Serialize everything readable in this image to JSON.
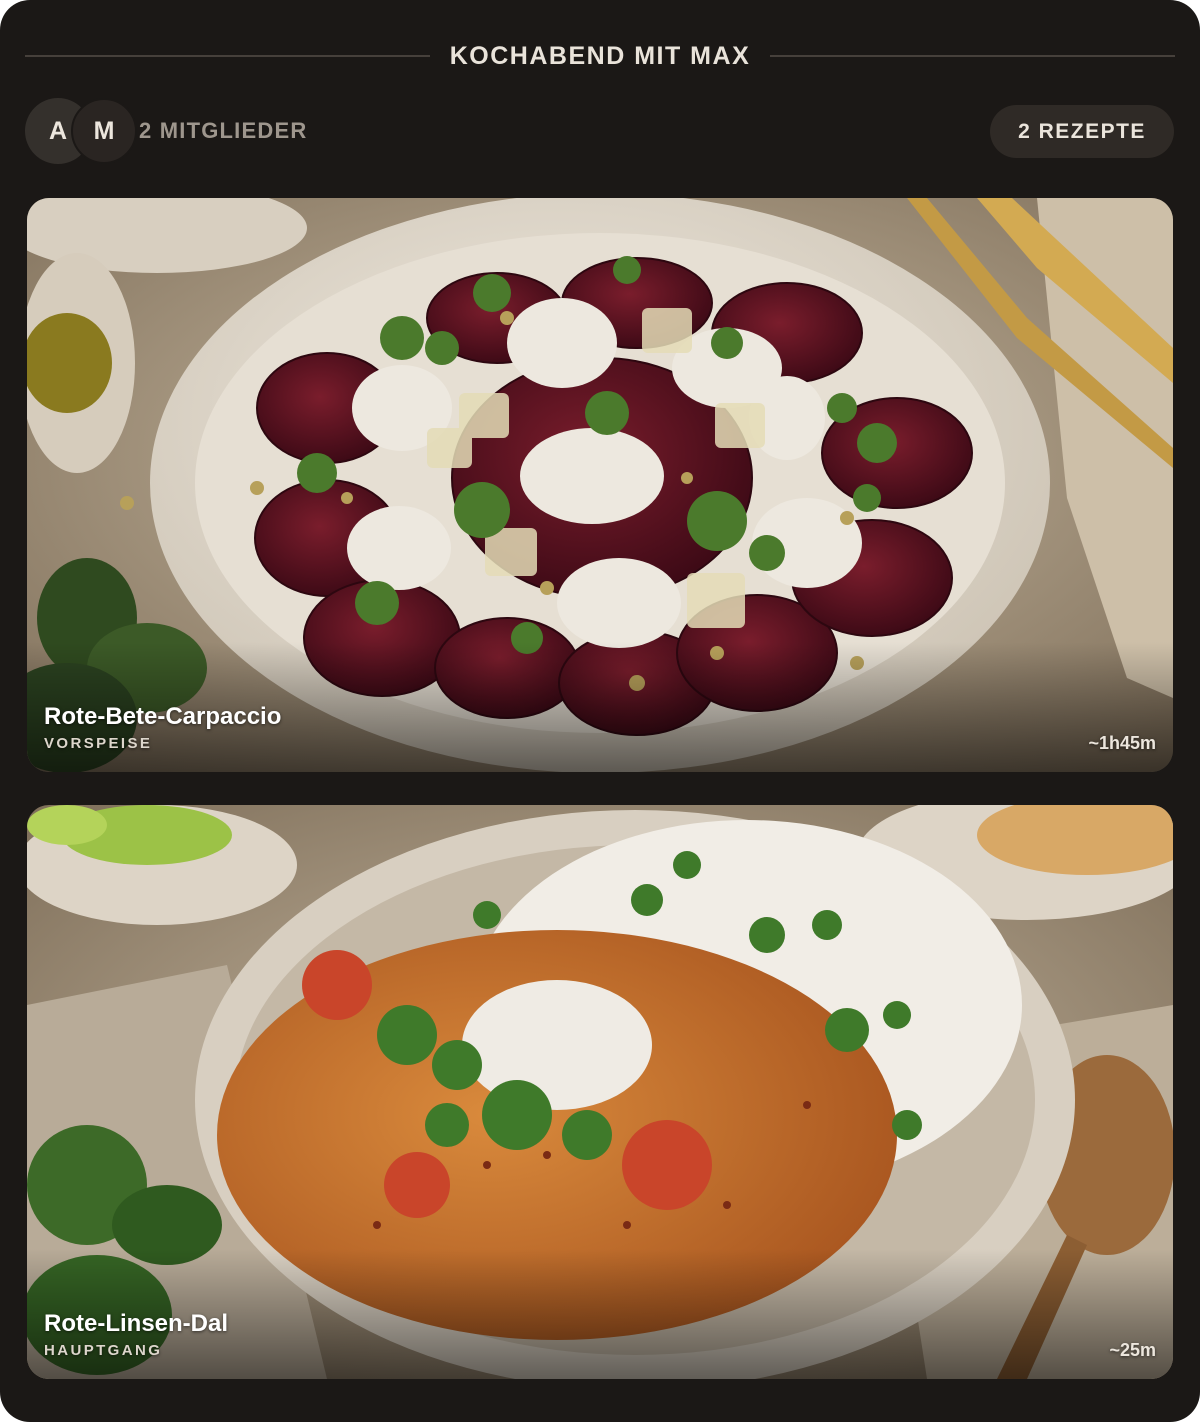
{
  "header": {
    "title": "KOCHABEND MIT MAX"
  },
  "members": {
    "avatars": [
      {
        "initial": "A"
      },
      {
        "initial": "M"
      }
    ],
    "label": "2 MITGLIEDER"
  },
  "recipe_count": "2 REZEPTE",
  "recipes": [
    {
      "name": "Rote-Bete-Carpaccio",
      "course": "VORSPEISE",
      "time": "~1h45m",
      "image": "beet-carpaccio-photo"
    },
    {
      "name": "Rote-Linsen-Dal",
      "course": "HAUPTGANG",
      "time": "~25m",
      "image": "red-lentil-dal-photo"
    }
  ]
}
